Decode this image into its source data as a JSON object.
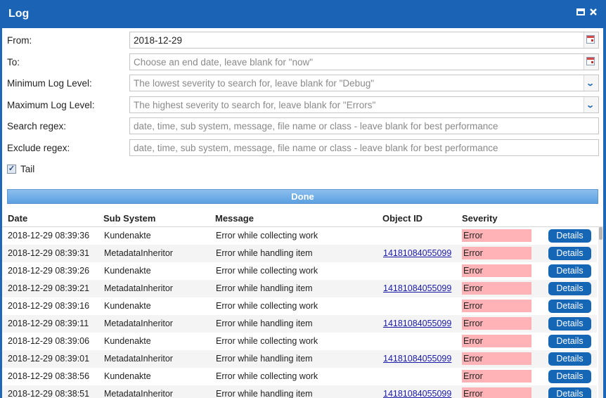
{
  "window": {
    "title": "Log",
    "maximize_icon": "maximize-icon",
    "close_icon": "close-icon"
  },
  "form": {
    "from": {
      "label": "From:",
      "value": "2018-12-29",
      "trigger_icon": "calendar-icon"
    },
    "to": {
      "label": "To:",
      "placeholder": "Choose an end date, leave blank for \"now\"",
      "trigger_icon": "calendar-icon"
    },
    "min_level": {
      "label": "Minimum Log Level:",
      "placeholder": "The lowest severity to search for, leave blank for \"Debug\"",
      "trigger_icon": "chevron-down-icon"
    },
    "max_level": {
      "label": "Maximum Log Level:",
      "placeholder": "The highest severity to search for, leave blank for \"Errors\"",
      "trigger_icon": "chevron-down-icon"
    },
    "search_regex": {
      "label": "Search regex:",
      "placeholder": "date, time, sub system, message, file name or class - leave blank for best performance"
    },
    "exclude_regex": {
      "label": "Exclude regex:",
      "placeholder": "date, time, sub system, message, file name or class - leave blank for best performance"
    },
    "tail": {
      "label": "Tail",
      "checked": true
    }
  },
  "done_button": {
    "label": "Done"
  },
  "grid": {
    "columns": [
      "Date",
      "Sub System",
      "Message",
      "Object ID",
      "Severity"
    ],
    "details_label": "Details",
    "rows": [
      {
        "date": "2018-12-29 08:39:36",
        "subsystem": "Kundenakte",
        "message": "Error while collecting work",
        "object_id": "",
        "severity": "Error"
      },
      {
        "date": "2018-12-29 08:39:31",
        "subsystem": "MetadataInheritor",
        "message": "Error while handling item",
        "object_id": "14181084055099",
        "severity": "Error"
      },
      {
        "date": "2018-12-29 08:39:26",
        "subsystem": "Kundenakte",
        "message": "Error while collecting work",
        "object_id": "",
        "severity": "Error"
      },
      {
        "date": "2018-12-29 08:39:21",
        "subsystem": "MetadataInheritor",
        "message": "Error while handling item",
        "object_id": "14181084055099",
        "severity": "Error"
      },
      {
        "date": "2018-12-29 08:39:16",
        "subsystem": "Kundenakte",
        "message": "Error while collecting work",
        "object_id": "",
        "severity": "Error"
      },
      {
        "date": "2018-12-29 08:39:11",
        "subsystem": "MetadataInheritor",
        "message": "Error while handling item",
        "object_id": "14181084055099",
        "severity": "Error"
      },
      {
        "date": "2018-12-29 08:39:06",
        "subsystem": "Kundenakte",
        "message": "Error while collecting work",
        "object_id": "",
        "severity": "Error"
      },
      {
        "date": "2018-12-29 08:39:01",
        "subsystem": "MetadataInheritor",
        "message": "Error while handling item",
        "object_id": "14181084055099",
        "severity": "Error"
      },
      {
        "date": "2018-12-29 08:38:56",
        "subsystem": "Kundenakte",
        "message": "Error while collecting work",
        "object_id": "",
        "severity": "Error"
      },
      {
        "date": "2018-12-29 08:38:51",
        "subsystem": "MetadataInheritor",
        "message": "Error while handling item",
        "object_id": "14181084055099",
        "severity": "Error"
      }
    ]
  }
}
